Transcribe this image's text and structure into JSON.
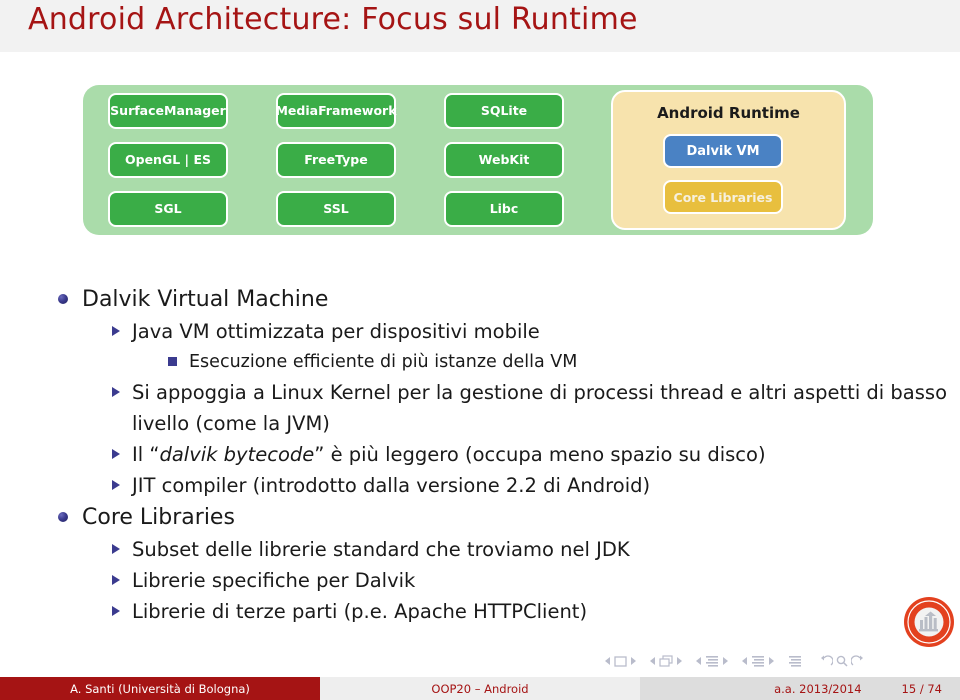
{
  "slide": {
    "title": "Android Architecture: Focus sul Runtime",
    "title_color": "#a51414"
  },
  "diagram": {
    "name": "android-architecture-libraries-runtime",
    "container_color": "#aadcaa",
    "box_color": "#3aad47",
    "columns": [
      {
        "boxes": [
          {
            "lines": [
              "Surface",
              "Manager"
            ]
          },
          {
            "lines": [
              "OpenGL | ES"
            ]
          },
          {
            "lines": [
              "SGL"
            ]
          }
        ]
      },
      {
        "boxes": [
          {
            "lines": [
              "Media",
              "Framework"
            ]
          },
          {
            "lines": [
              "FreeType"
            ]
          },
          {
            "lines": [
              "SSL"
            ]
          }
        ]
      },
      {
        "boxes": [
          {
            "lines": [
              "SQLite"
            ]
          },
          {
            "lines": [
              "WebKit"
            ]
          },
          {
            "lines": [
              "Libc"
            ]
          }
        ]
      }
    ],
    "runtime": {
      "title": "Android Runtime",
      "panel_color": "#f7e3ad",
      "dalvik_vm": {
        "label": "Dalvik VM",
        "color": "#4a82c4"
      },
      "core_libraries": {
        "label": "Core Libraries",
        "color": "#e8bf3e"
      }
    }
  },
  "content": {
    "bullet_color": "#3b3b8f",
    "items": [
      {
        "level": 1,
        "marker": "disc",
        "text": "Dalvik Virtual Machine"
      },
      {
        "level": 2,
        "marker": "triangle",
        "text": "Java VM ottimizzata per dispositivi mobile"
      },
      {
        "level": 3,
        "marker": "square",
        "text": "Esecuzione efficiente di più istanze della VM"
      },
      {
        "level": 2,
        "marker": "triangle",
        "text": "Si appoggia a Linux Kernel per la gestione di processi thread e altri aspetti di basso livello (come la JVM)"
      },
      {
        "level": 2,
        "marker": "triangle",
        "text": "Il “dalvik bytecode” è più leggero (occupa meno spazio su disco)",
        "italic_part": "dalvik bytecode"
      },
      {
        "level": 2,
        "marker": "triangle",
        "text": "JIT compiler (introdotto dalla versione 2.2 di Android)"
      },
      {
        "level": 1,
        "marker": "disc",
        "text": "Core Libraries"
      },
      {
        "level": 2,
        "marker": "triangle",
        "text": "Subset delle librerie standard che troviamo nel JDK"
      },
      {
        "level": 2,
        "marker": "triangle",
        "text": "Librerie specifiche per Dalvik"
      },
      {
        "level": 2,
        "marker": "triangle",
        "text": "Librerie di terze parti (p.e. Apache HTTPClient)"
      }
    ]
  },
  "navigation": {
    "icons": [
      "prev-slide-arrow-icon",
      "slide-icon",
      "next-slide-arrow-icon",
      "prev-frame-arrow-icon",
      "frames-icon",
      "next-frame-arrow-icon",
      "prev-subsection-arrow-icon",
      "subsection-icon",
      "next-subsection-arrow-icon",
      "prev-section-arrow-icon",
      "section-icon",
      "next-section-arrow-icon",
      "document-icon",
      "back-icon",
      "search-icon",
      "forward-icon"
    ]
  },
  "logo": {
    "name": "university-of-bologna-seal",
    "color": "#e3411f"
  },
  "footer": {
    "author": "A. Santi  (Università di Bologna)",
    "course": "OOP20 – Android",
    "academic_year": "a.a. 2013/2014",
    "page": "15 / 74",
    "author_bg": "#a51414",
    "course_bg": "#eeeeee",
    "right_bg": "#dddddd"
  }
}
